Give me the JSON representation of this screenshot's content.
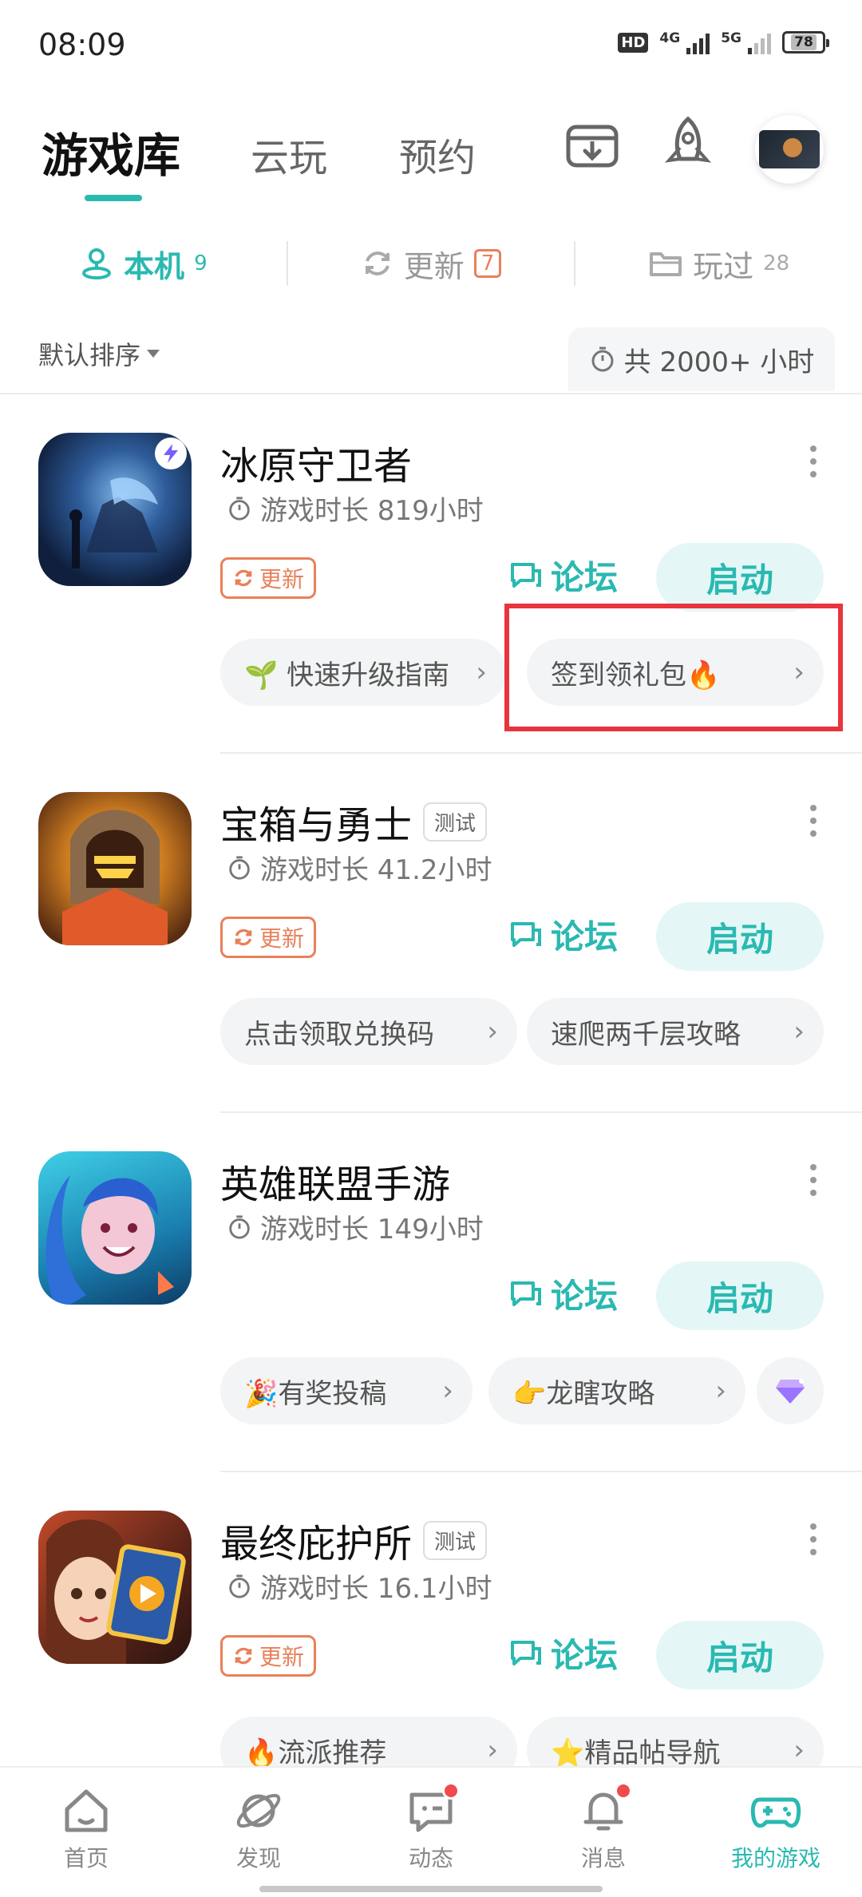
{
  "status_bar": {
    "time": "08:09",
    "hd": "HD",
    "network": "4G",
    "network2": "5G",
    "battery": "78"
  },
  "header": {
    "tabs": [
      "游戏库",
      "云玩",
      "预约"
    ]
  },
  "subtabs": [
    {
      "label": "本机",
      "count": "9"
    },
    {
      "label": "更新",
      "count": "7"
    },
    {
      "label": "玩过",
      "count": "28"
    }
  ],
  "sort_label": "默认排序",
  "total_time": "共 2000+ 小时",
  "colors": {
    "accent": "#2ab9b1",
    "update": "#e9805a",
    "highlight": "#e8343d"
  },
  "games": [
    {
      "name": "冰原守卫者",
      "time": "游戏时长 819小时",
      "update": "更新",
      "forum": "论坛",
      "launch": "启动",
      "chips": [
        "🌱 快速升级指南",
        "签到领礼包🔥"
      ]
    },
    {
      "name": "宝箱与勇士",
      "tag": "测试",
      "time": "游戏时长 41.2小时",
      "update": "更新",
      "forum": "论坛",
      "launch": "启动",
      "chips": [
        "点击领取兑换码",
        "速爬两千层攻略"
      ]
    },
    {
      "name": "英雄联盟手游",
      "time": "游戏时长 149小时",
      "forum": "论坛",
      "launch": "启动",
      "chips": [
        "🎉有奖投稿",
        "👉龙瞎攻略"
      ]
    },
    {
      "name": "最终庇护所",
      "tag": "测试",
      "time": "游戏时长 16.1小时",
      "update": "更新",
      "forum": "论坛",
      "launch": "启动",
      "chips": [
        "🔥流派推荐",
        "⭐精品帖导航"
      ]
    }
  ],
  "nav": [
    {
      "label": "首页",
      "icon": "home-icon"
    },
    {
      "label": "发现",
      "icon": "planet-icon"
    },
    {
      "label": "动态",
      "icon": "chat-icon"
    },
    {
      "label": "消息",
      "icon": "bell-icon"
    },
    {
      "label": "我的游戏",
      "icon": "gamepad-icon"
    }
  ]
}
